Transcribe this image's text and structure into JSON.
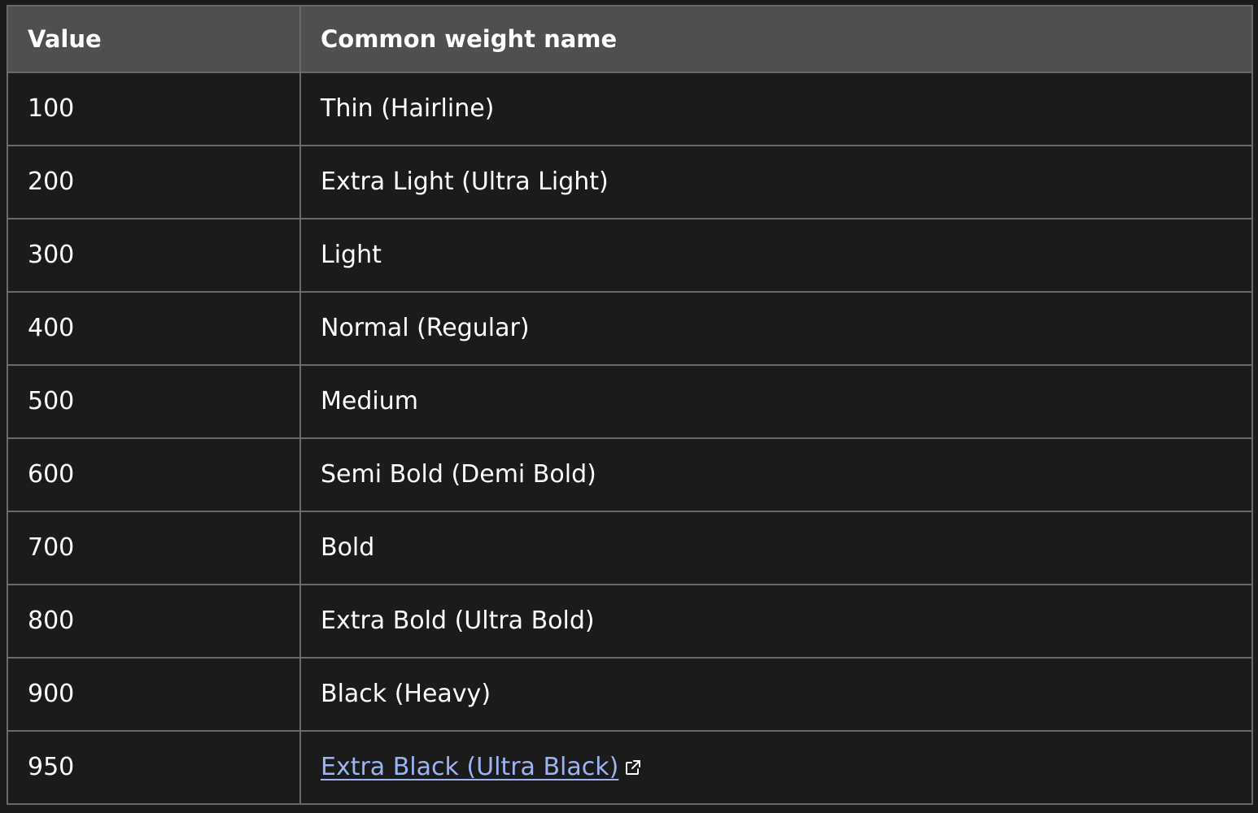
{
  "table": {
    "headers": [
      "Value",
      "Common weight name"
    ],
    "rows": [
      {
        "value": "100",
        "name": "Thin (Hairline)"
      },
      {
        "value": "200",
        "name": "Extra Light (Ultra Light)"
      },
      {
        "value": "300",
        "name": "Light"
      },
      {
        "value": "400",
        "name": "Normal (Regular)"
      },
      {
        "value": "500",
        "name": "Medium"
      },
      {
        "value": "600",
        "name": "Semi Bold (Demi Bold)"
      },
      {
        "value": "700",
        "name": "Bold"
      },
      {
        "value": "800",
        "name": "Extra Bold (Ultra Bold)"
      },
      {
        "value": "900",
        "name": "Black (Heavy)"
      },
      {
        "value": "950",
        "name": "Extra Black (Ultra Black)",
        "link": true,
        "icon": "external-link-icon"
      }
    ]
  },
  "colors": {
    "background": "#1b1b1b",
    "header_background": "#4f4f4f",
    "border": "#6a6a6a",
    "text": "#ffffff",
    "link": "#9db4f0"
  }
}
